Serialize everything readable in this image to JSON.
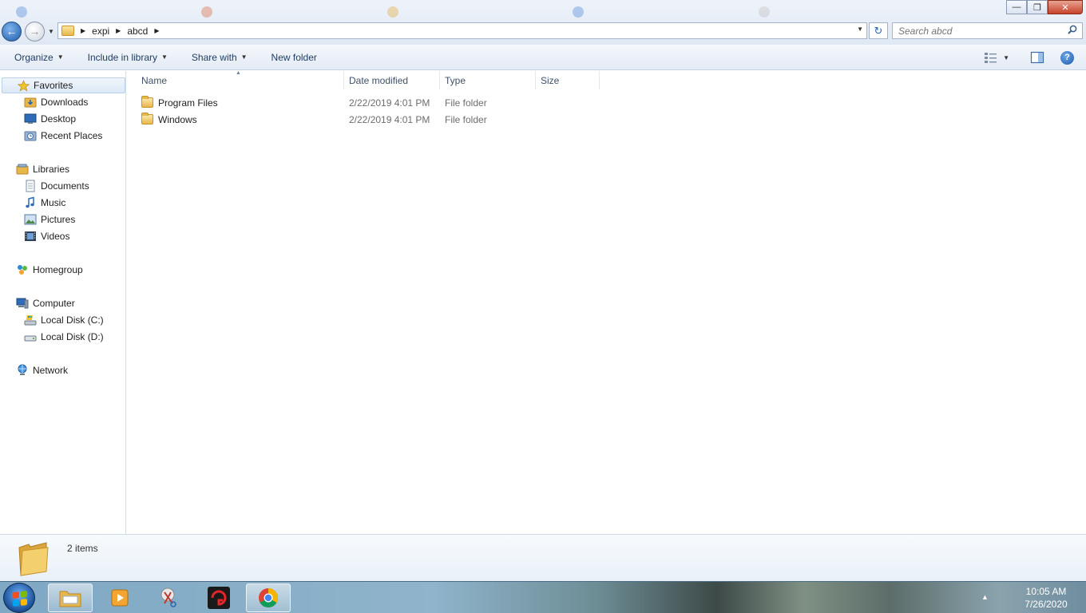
{
  "window": {
    "background_tabs": [
      "",
      "",
      "",
      "",
      ""
    ],
    "buttons": {
      "minimize": "—",
      "maximize": "❐",
      "close": "✕"
    }
  },
  "address_bar": {
    "breadcrumbs": [
      "expi",
      "abcd"
    ],
    "search_placeholder": "Search abcd"
  },
  "toolbar": {
    "organize": "Organize",
    "include_in_library": "Include in library",
    "share_with": "Share with",
    "new_folder": "New folder",
    "help_glyph": "?"
  },
  "sidebar": {
    "favorites": {
      "label": "Favorites",
      "items": [
        "Downloads",
        "Desktop",
        "Recent Places"
      ]
    },
    "libraries": {
      "label": "Libraries",
      "items": [
        "Documents",
        "Music",
        "Pictures",
        "Videos"
      ]
    },
    "homegroup": "Homegroup",
    "computer": {
      "label": "Computer",
      "items": [
        "Local Disk (C:)",
        "Local Disk (D:)"
      ]
    },
    "network": "Network"
  },
  "file_list": {
    "columns": [
      "Name",
      "Date modified",
      "Type",
      "Size"
    ],
    "rows": [
      {
        "name": "Program Files",
        "date": "2/22/2019 4:01 PM",
        "type": "File folder",
        "size": ""
      },
      {
        "name": "Windows",
        "date": "2/22/2019 4:01 PM",
        "type": "File folder",
        "size": ""
      }
    ]
  },
  "details_pane": {
    "item_count": "2 items"
  },
  "taskbar": {
    "time": "10:05 AM",
    "date": "7/26/2020"
  },
  "colors": {
    "accent_blue": "#1f5ea8",
    "folder_yellow": "#e8b74c",
    "selection": "#dce8f6"
  }
}
